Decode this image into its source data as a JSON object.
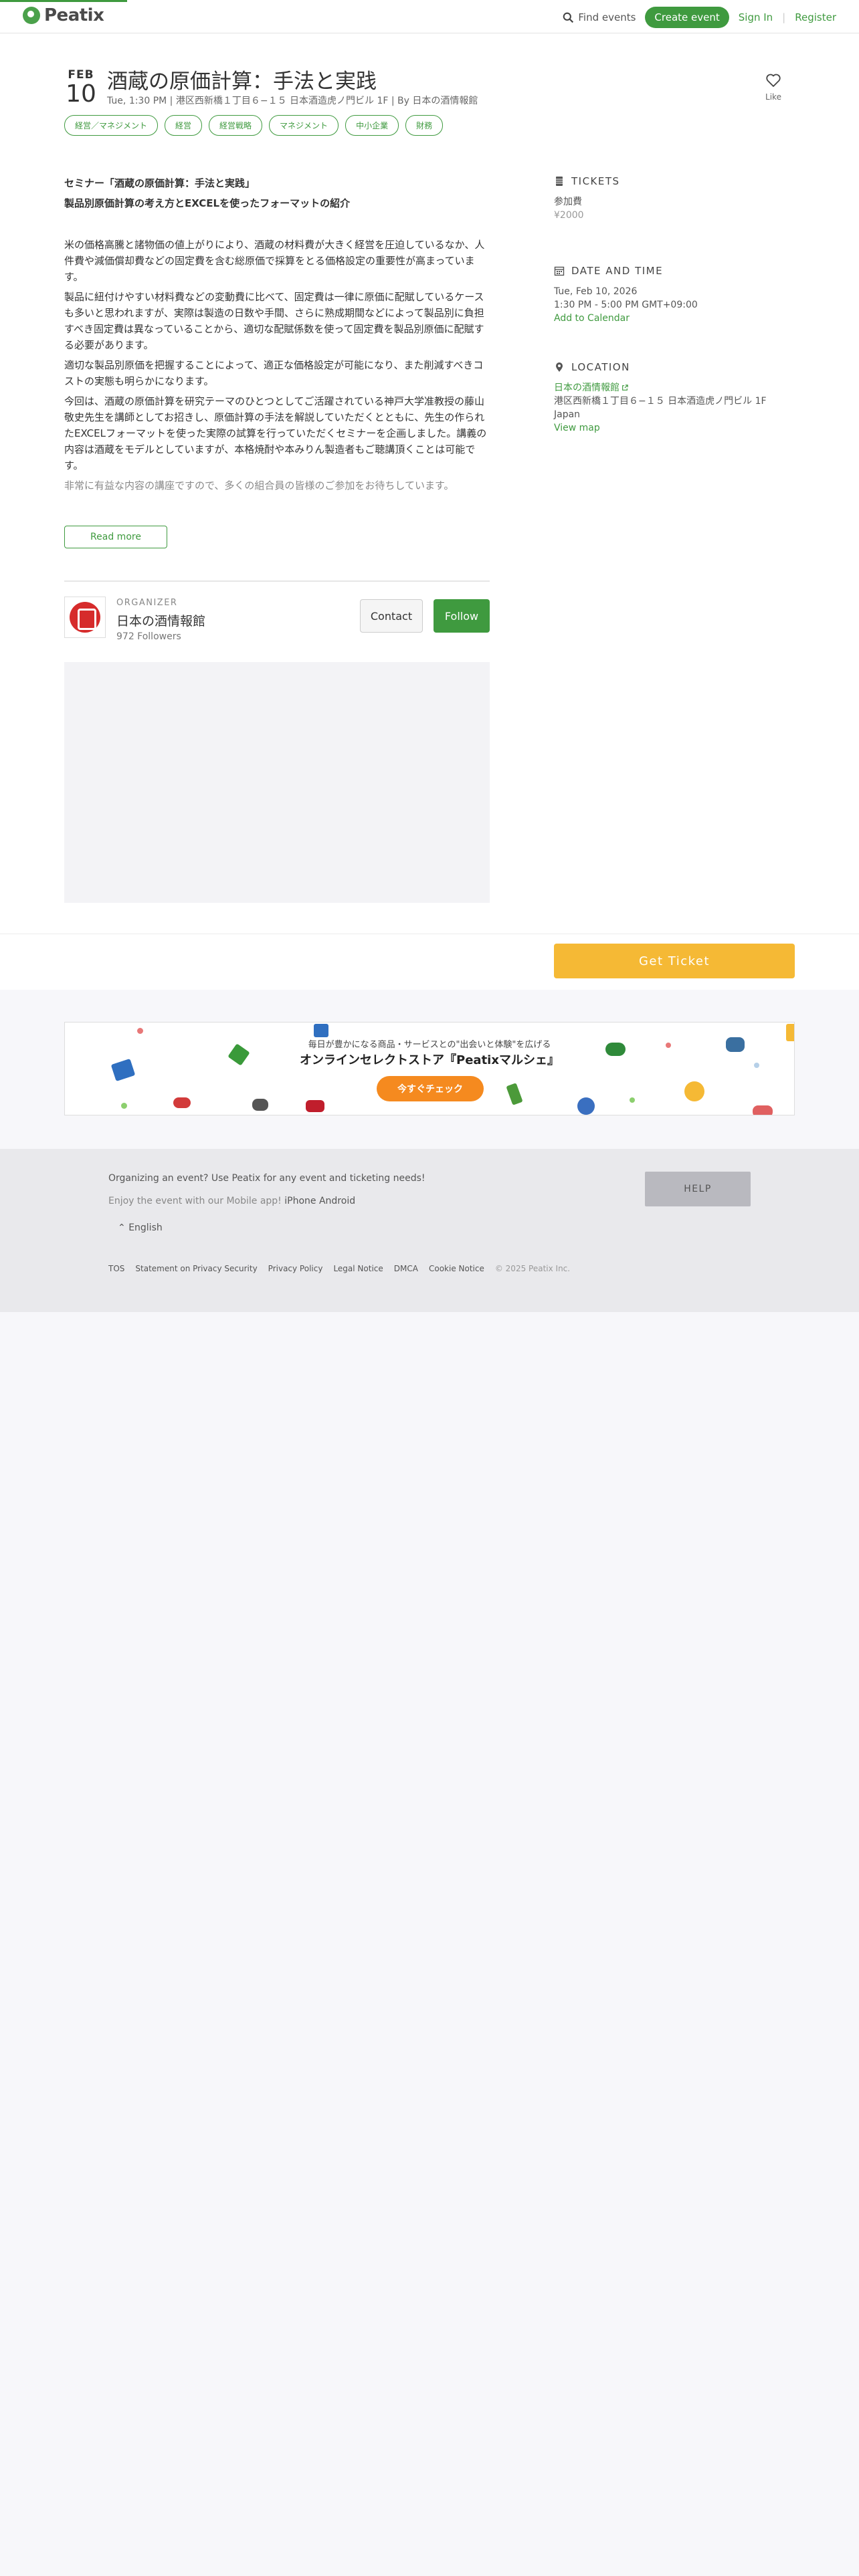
{
  "header": {
    "logo": "Peatix",
    "find_events": "Find events",
    "create_event": "Create event",
    "sign_in": "Sign In",
    "separator": "|",
    "register": "Register"
  },
  "event": {
    "month": "FEB",
    "day": "10",
    "title": "酒蔵の原価計算：手法と実践",
    "meta": "Tue, 1:30 PM | 港区西新橋１丁目６−１５ 日本酒造虎ノ門ビル 1F | By 日本の酒情報館",
    "like_label": "Like",
    "tags": [
      "経営／マネジメント",
      "経営",
      "経営戦略",
      "マネジメント",
      "中小企業",
      "財務"
    ]
  },
  "description": {
    "heading1": "セミナー「酒蔵の原価計算：手法と実践」",
    "heading2": "製品別原価計算の考え方とEXCELを使ったフォーマットの紹介",
    "paragraphs": [
      "米の価格高騰と諸物価の値上がりにより、酒蔵の材料費が大きく経営を圧迫しているなか、人件費や減価償却費などの固定費を含む総原価で採算をとる価格設定の重要性が高まっています。",
      "製品に紐付けやすい材料費などの変動費に比べて、固定費は一律に原価に配賦しているケースも多いと思われますが、実際は製造の日数や手間、さらに熟成期間などによって製品別に負担すべき固定費は異なっていることから、適切な配賦係数を使って固定費を製品別原価に配賦する必要があります。",
      "適切な製品別原価を把握することによって、適正な価格設定が可能になり、また削減すべきコストの実態も明らかになります。",
      "今回は、酒蔵の原価計算を研究テーマのひとつとしてご活躍されている神戸大学准教授の藤山敬史先生を講師としてお招きし、原価計算の手法を解説していただくとともに、先生の作られたEXCELフォーマットを使った実際の試算を行っていただくセミナーを企画しました。講義の内容は酒蔵をモデルとしていますが、本格焼酎や本みりん製造者もご聴講頂くことは可能です。"
    ],
    "faded": "非常に有益な内容の講座ですので、多くの組合員の皆様のご参加をお待ちしています。",
    "read_more": "Read more"
  },
  "organizer": {
    "label": "ORGANIZER",
    "name": "日本の酒情報館",
    "followers": "972 Followers",
    "contact": "Contact",
    "follow": "Follow"
  },
  "tickets": {
    "heading": "TICKETS",
    "name": "参加費",
    "price": "¥2000"
  },
  "datetime": {
    "heading": "DATE AND TIME",
    "date": "Tue, Feb 10, 2026",
    "time": "1:30 PM - 5:00 PM GMT+09:00",
    "add_calendar": "Add to Calendar"
  },
  "location": {
    "heading": "LOCATION",
    "venue": "日本の酒情報館",
    "address": "港区西新橋１丁目６−１５ 日本酒造虎ノ門ビル 1F",
    "country": "Japan",
    "view_map": "View map"
  },
  "ticket_bar": {
    "get_ticket": "Get Ticket"
  },
  "banner": {
    "subtitle": "毎日が豊かになる商品・サービスとの\"出会いと体験\"を広げる",
    "title": "オンラインセレクトストア『Peatixマルシェ』",
    "button": "今すぐチェック"
  },
  "footer": {
    "organizing": "Organizing an event? Use Peatix for any event and ticketing needs!",
    "mobile_prefix": "Enjoy the event with our Mobile app!",
    "iphone": "iPhone",
    "android": "Android",
    "language": "English",
    "help": "HELP",
    "links": [
      "TOS",
      "Statement on Privacy Security",
      "Privacy Policy",
      "Legal Notice",
      "DMCA",
      "Cookie Notice"
    ],
    "copyright": "© 2025 Peatix Inc."
  },
  "colors": {
    "brand_green": "#3f9a3f",
    "ticket_yellow": "#f5b935",
    "banner_orange": "#f58a1f"
  }
}
